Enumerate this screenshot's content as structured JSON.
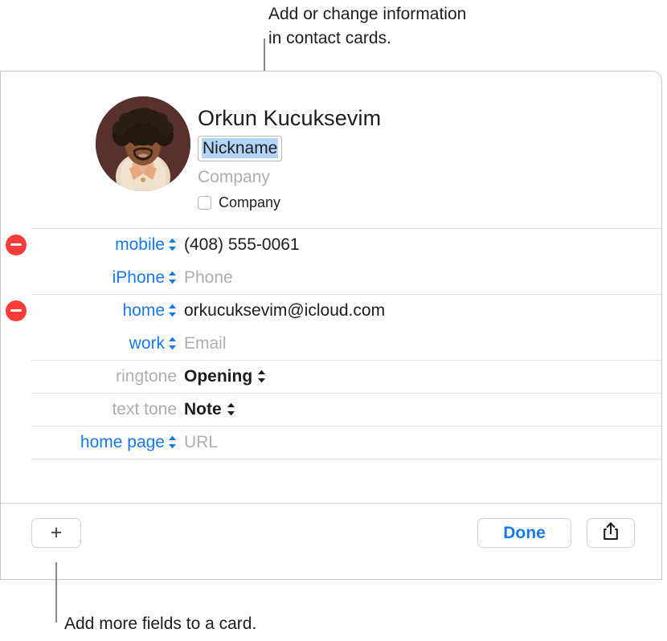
{
  "callouts": {
    "top": "Add or change information\nin contact cards.",
    "bottom": "Add more fields to a card."
  },
  "colors": {
    "accent_blue": "#1878f0",
    "remove_red": "#fc3d39",
    "selection_blue": "#b4d5fb",
    "placeholder_gray": "#aeaeb2",
    "rule_gray": "#e3e3e3"
  },
  "card": {
    "avatar_name": "contact-photo",
    "contact_name": "Orkun Kucuksevim",
    "nickname_value": "Nickname",
    "company_placeholder": "Company",
    "company_checkbox_label": "Company",
    "company_checkbox_checked": false
  },
  "fields": [
    {
      "id": "phone-mobile",
      "removable": true,
      "label": "mobile",
      "label_style": "link",
      "has_label_stepper": true,
      "value": "(408) 555-0061",
      "value_is_placeholder": false,
      "value_style": "normal",
      "has_value_stepper": false,
      "rule": true
    },
    {
      "id": "phone-iphone",
      "removable": false,
      "label": "iPhone",
      "label_style": "link",
      "has_label_stepper": true,
      "value": "Phone",
      "value_is_placeholder": true,
      "value_style": "normal",
      "has_value_stepper": false,
      "rule": false
    },
    {
      "id": "email-home",
      "removable": true,
      "label": "home",
      "label_style": "link",
      "has_label_stepper": true,
      "value": "orkucuksevim@icloud.com",
      "value_is_placeholder": false,
      "value_style": "normal",
      "has_value_stepper": false,
      "rule": true
    },
    {
      "id": "email-work",
      "removable": false,
      "label": "work",
      "label_style": "link",
      "has_label_stepper": true,
      "value": "Email",
      "value_is_placeholder": true,
      "value_style": "normal",
      "has_value_stepper": false,
      "rule": false
    },
    {
      "id": "ringtone",
      "removable": false,
      "label": "ringtone",
      "label_style": "muted",
      "has_label_stepper": false,
      "value": "Opening",
      "value_is_placeholder": false,
      "value_style": "strong",
      "has_value_stepper": true,
      "rule": true
    },
    {
      "id": "text-tone",
      "removable": false,
      "label": "text tone",
      "label_style": "muted",
      "has_label_stepper": false,
      "value": "Note",
      "value_is_placeholder": false,
      "value_style": "strong",
      "has_value_stepper": true,
      "rule": true
    },
    {
      "id": "home-page",
      "removable": false,
      "label": "home page",
      "label_style": "link",
      "has_label_stepper": true,
      "value": "URL",
      "value_is_placeholder": true,
      "value_style": "normal",
      "has_value_stepper": false,
      "rule": true
    }
  ],
  "toolbar": {
    "add_field_glyph": "+",
    "done_label": "Done",
    "share_icon": "share-icon"
  }
}
